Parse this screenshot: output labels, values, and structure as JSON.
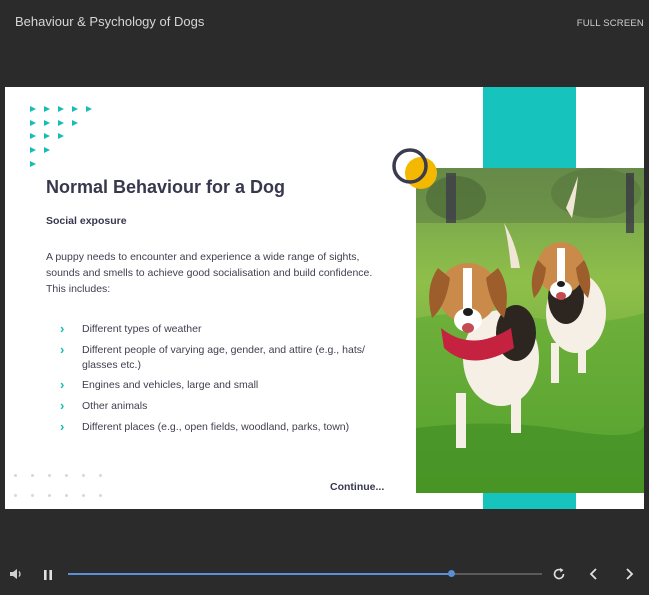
{
  "header": {
    "course_title": "Behaviour & Psychology of Dogs",
    "fullscreen_label": "FULL SCREEN"
  },
  "slide": {
    "title": "Normal Behaviour for a Dog",
    "subheading": "Social exposure",
    "intro": "A puppy needs to encounter and experience a wide range of sights, sounds and smells to achieve good socialisation and build confidence. This includes:",
    "bullets": [
      "Different types of weather",
      "Different people of varying age, gender, and attire (e.g., hats/ glasses etc.)",
      "Engines and vehicles, large and small",
      "Other animals",
      "Different places (e.g., open fields, woodland, parks, town)"
    ],
    "continue_label": "Continue...",
    "photo_description_icon": "beagles-photo"
  },
  "player": {
    "progress": 0.81,
    "icons": [
      "volume-icon",
      "pause-icon",
      "replay-icon",
      "prev-icon",
      "next-icon"
    ]
  },
  "colors": {
    "accent_teal": "#16c4bd",
    "accent_yellow": "#f5b800",
    "progress_blue": "#5b8ed6",
    "title_navy": "#37374d",
    "background": "#2b2b2b"
  }
}
